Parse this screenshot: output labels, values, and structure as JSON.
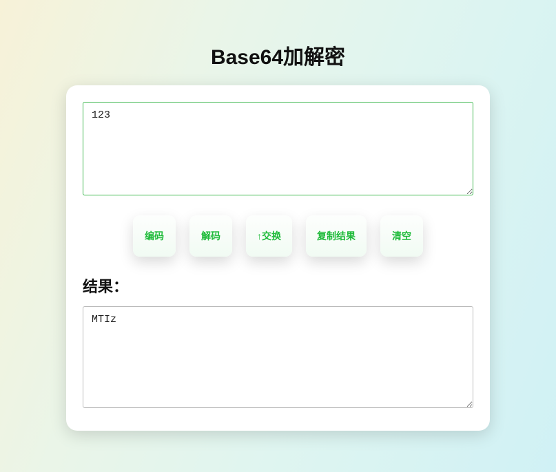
{
  "title": "Base64加解密",
  "input": {
    "value": "123"
  },
  "buttons": {
    "encode": "编码",
    "decode": "解码",
    "swap": "↑交换",
    "copy": "复制结果",
    "clear": "清空"
  },
  "result_label": "结果：",
  "result": {
    "value": "MTIz"
  }
}
